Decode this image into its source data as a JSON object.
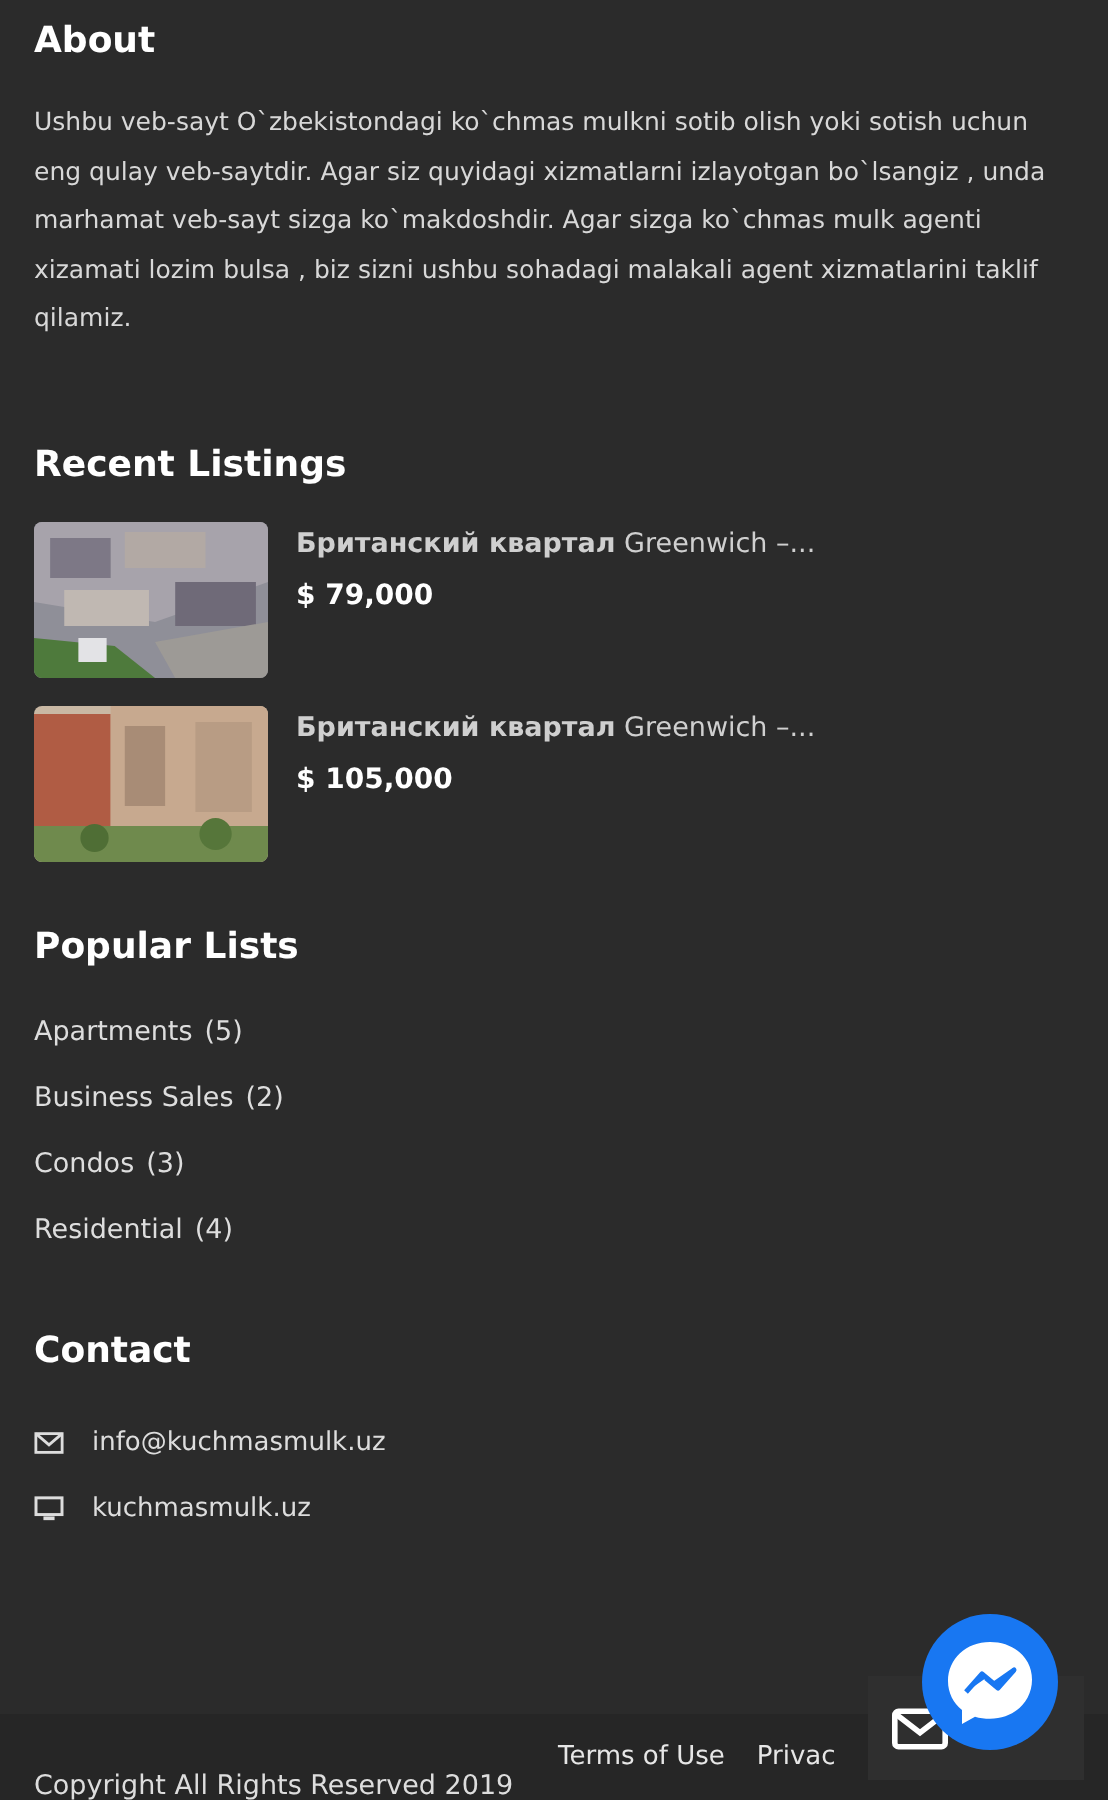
{
  "about": {
    "title": "About",
    "text": "Ushbu veb-sayt O`zbekistondagi ko`chmas mulkni sotib olish yoki sotish uchun eng qulay veb-saytdir. Agar siz quyidagi xizmatlarni izlayotgan bo`lsangiz , unda marhamat veb-sayt sizga ko`makdoshdir. Agar sizga ko`chmas mulk agenti xizamati lozim bulsa , biz sizni ushbu sohadagi malakali agent xizmatlarini taklif qilamiz."
  },
  "recent": {
    "title": "Recent Listings",
    "items": [
      {
        "kind": "picture",
        "name": "**Британский квартал** Greenwich –...",
        "price": "$ 79,000"
      },
      {
        "kind": "picture",
        "name": "**Британский квартал** Greenwich –...",
        "price": "$ 105,000"
      }
    ]
  },
  "popular": {
    "title": "Popular Lists",
    "items": [
      {
        "label": "Apartments",
        "count": "(5)"
      },
      {
        "label": "Business Sales",
        "count": "(2)"
      },
      {
        "label": "Condos",
        "count": "(3)"
      },
      {
        "label": "Residential",
        "count": "(4)"
      }
    ]
  },
  "contact": {
    "title": "Contact",
    "items": [
      {
        "kind": "email",
        "text": "info@kuchmasmulk.uz"
      },
      {
        "kind": "web",
        "text": "kuchmasmulk.uz"
      }
    ]
  },
  "footer": {
    "links": [
      "Terms of Use",
      "Privac"
    ],
    "copyright": "Copyright All Rights Reserved 2019"
  }
}
